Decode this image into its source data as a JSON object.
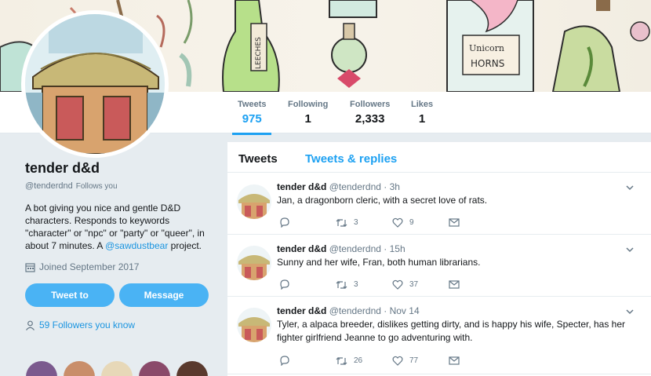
{
  "profile": {
    "name": "tender d&d",
    "handle": "@tenderdnd",
    "follows_you": "Follows you",
    "bio_text": "A bot giving you nice and gentle D&D characters. Responds to keywords \"character\" or \"npc\" or \"party\" or \"queer\", in about 7 minutes. A",
    "bio_link": "@sawdustbear",
    "bio_suffix": " project.",
    "joined": "Joined September 2017",
    "tweet_to_label": "Tweet to",
    "message_label": "Message",
    "followers_you_know": "59 Followers you know"
  },
  "banner": {
    "jar_label_1": "LEECHES",
    "jar_label_2a": "Unicorn",
    "jar_label_2b": "HORNS"
  },
  "stats": [
    {
      "label": "Tweets",
      "value": "975"
    },
    {
      "label": "Following",
      "value": "1"
    },
    {
      "label": "Followers",
      "value": "2,333"
    },
    {
      "label": "Likes",
      "value": "1"
    }
  ],
  "tabs": {
    "tweets": "Tweets",
    "replies": "Tweets & replies"
  },
  "tweets": [
    {
      "name": "tender d&d",
      "handle": "@tenderdnd",
      "time": "· 3h",
      "text": "Jan, a dragonborn cleric, with a secret love of rats.",
      "retweets": "3",
      "likes": "9"
    },
    {
      "name": "tender d&d",
      "handle": "@tenderdnd",
      "time": "· 15h",
      "text": "Sunny and her wife, Fran, both human librarians.",
      "retweets": "3",
      "likes": "37"
    },
    {
      "name": "tender d&d",
      "handle": "@tenderdnd",
      "time": "· Nov 14",
      "text": "Tyler, a alpaca breeder, dislikes getting dirty, and is happy his wife, Specter, has her fighter girlfriend Jeanne to go adventuring with.",
      "retweets": "26",
      "likes": "77"
    }
  ],
  "colors": {
    "accent": "#1da1f2",
    "button": "#4ab3f4"
  }
}
